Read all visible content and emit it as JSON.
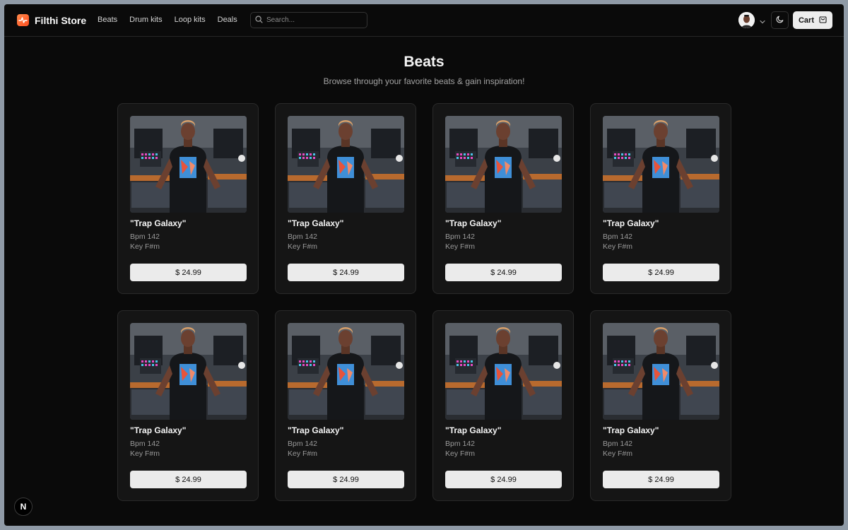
{
  "header": {
    "brand": "Filthi Store",
    "nav": [
      "Beats",
      "Drum kits",
      "Loop kits",
      "Deals"
    ],
    "search_placeholder": "Search...",
    "cart_label": "Cart"
  },
  "page": {
    "title": "Beats",
    "subtitle": "Browse through your favorite beats & gain inspiration!"
  },
  "products": [
    {
      "title": "\"Trap Galaxy\"",
      "bpm": "Bpm 142",
      "key": "Key F#m",
      "price": "$ 24.99"
    },
    {
      "title": "\"Trap Galaxy\"",
      "bpm": "Bpm 142",
      "key": "Key F#m",
      "price": "$ 24.99"
    },
    {
      "title": "\"Trap Galaxy\"",
      "bpm": "Bpm 142",
      "key": "Key F#m",
      "price": "$ 24.99"
    },
    {
      "title": "\"Trap Galaxy\"",
      "bpm": "Bpm 142",
      "key": "Key F#m",
      "price": "$ 24.99"
    },
    {
      "title": "\"Trap Galaxy\"",
      "bpm": "Bpm 142",
      "key": "Key F#m",
      "price": "$ 24.99"
    },
    {
      "title": "\"Trap Galaxy\"",
      "bpm": "Bpm 142",
      "key": "Key F#m",
      "price": "$ 24.99"
    },
    {
      "title": "\"Trap Galaxy\"",
      "bpm": "Bpm 142",
      "key": "Key F#m",
      "price": "$ 24.99"
    },
    {
      "title": "\"Trap Galaxy\"",
      "bpm": "Bpm 142",
      "key": "Key F#m",
      "price": "$ 24.99"
    }
  ],
  "badge": "N",
  "colors": {
    "accent": "#ff5a24",
    "background": "#0a0a0a",
    "card": "#151515",
    "button": "#ebebeb"
  },
  "icons": [
    "logo-icon",
    "search-icon",
    "avatar",
    "chevron-down-icon",
    "moon-icon",
    "cart-bag-icon",
    "nextjs-icon"
  ]
}
